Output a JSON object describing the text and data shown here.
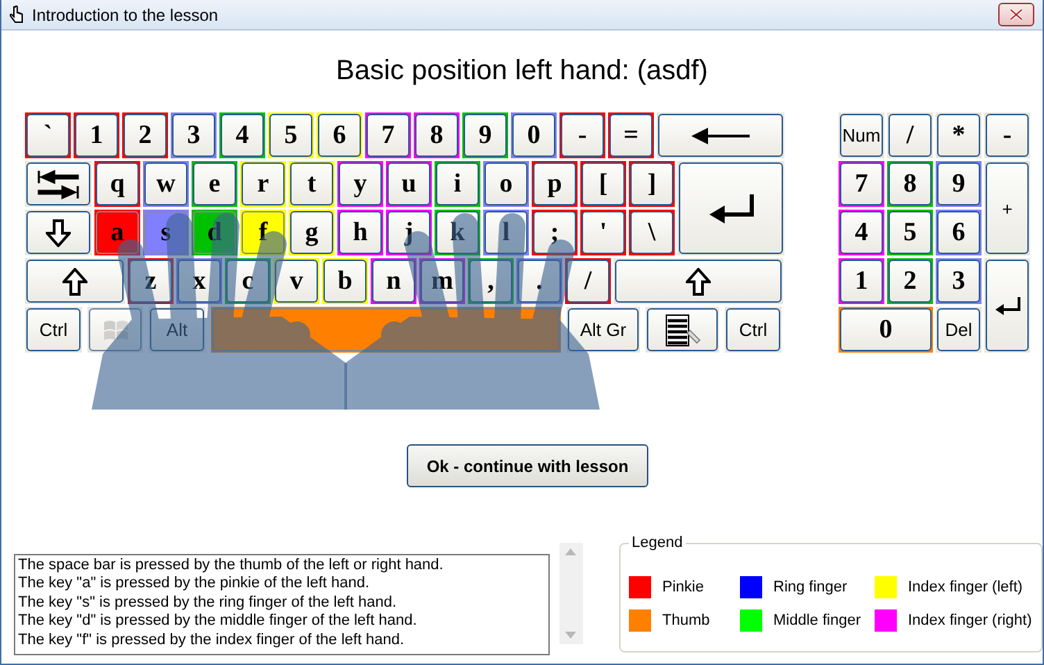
{
  "window": {
    "title": "Introduction to the lesson"
  },
  "heading": "Basic position left hand: (asdf)",
  "keyboard": {
    "rows": [
      {
        "keys": [
          {
            "kind": "char",
            "label": "`",
            "color": "#ff0000",
            "highlighted": false
          },
          {
            "kind": "char",
            "label": "1",
            "color": "#ff0000",
            "highlighted": false
          },
          {
            "kind": "char",
            "label": "2",
            "color": "#ff0000",
            "highlighted": false
          },
          {
            "kind": "char",
            "label": "3",
            "color": "#8080ff",
            "highlighted": false
          },
          {
            "kind": "char",
            "label": "4",
            "color": "#00c000",
            "highlighted": false
          },
          {
            "kind": "char",
            "label": "5",
            "color": "#ffff00",
            "highlighted": false
          },
          {
            "kind": "char",
            "label": "6",
            "color": "#ffff00",
            "highlighted": false
          },
          {
            "kind": "char",
            "label": "7",
            "color": "#ff00ff",
            "highlighted": false
          },
          {
            "kind": "char",
            "label": "8",
            "color": "#ff00ff",
            "highlighted": false
          },
          {
            "kind": "char",
            "label": "9",
            "color": "#00c000",
            "highlighted": false
          },
          {
            "kind": "char",
            "label": "0",
            "color": "#8080ff",
            "highlighted": false
          },
          {
            "kind": "char",
            "label": "-",
            "color": "#ff0000",
            "highlighted": false
          },
          {
            "kind": "char",
            "label": "=",
            "color": "#ff0000",
            "highlighted": false
          },
          {
            "kind": "backspace",
            "highlighted": false
          }
        ]
      },
      {
        "keys": [
          {
            "kind": "tab",
            "highlighted": false
          },
          {
            "kind": "char",
            "label": "q",
            "color": "#ff0000",
            "highlighted": false
          },
          {
            "kind": "char",
            "label": "w",
            "color": "#8080ff",
            "highlighted": false
          },
          {
            "kind": "char",
            "label": "e",
            "color": "#00c000",
            "highlighted": false
          },
          {
            "kind": "char",
            "label": "r",
            "color": "#ffff00",
            "highlighted": false
          },
          {
            "kind": "char",
            "label": "t",
            "color": "#ffff00",
            "highlighted": false
          },
          {
            "kind": "char",
            "label": "y",
            "color": "#ff00ff",
            "highlighted": false
          },
          {
            "kind": "char",
            "label": "u",
            "color": "#ff00ff",
            "highlighted": false
          },
          {
            "kind": "char",
            "label": "i",
            "color": "#00c000",
            "highlighted": false
          },
          {
            "kind": "char",
            "label": "o",
            "color": "#8080ff",
            "highlighted": false
          },
          {
            "kind": "char",
            "label": "p",
            "color": "#ff0000",
            "highlighted": false
          },
          {
            "kind": "char",
            "label": "[",
            "color": "#ff0000",
            "highlighted": false
          },
          {
            "kind": "char",
            "label": "]",
            "color": "#ff0000",
            "highlighted": false
          },
          {
            "kind": "enter",
            "highlighted": false
          }
        ]
      },
      {
        "keys": [
          {
            "kind": "caps",
            "highlighted": false
          },
          {
            "kind": "char",
            "label": "a",
            "color": "#ff0000",
            "highlighted": true
          },
          {
            "kind": "char",
            "label": "s",
            "color": "#8080ff",
            "highlighted": true
          },
          {
            "kind": "char",
            "label": "d",
            "color": "#00c000",
            "highlighted": true
          },
          {
            "kind": "char",
            "label": "f",
            "color": "#ffff00",
            "highlighted": true
          },
          {
            "kind": "char",
            "label": "g",
            "color": "#ffff00",
            "highlighted": false
          },
          {
            "kind": "char",
            "label": "h",
            "color": "#ff00ff",
            "highlighted": false
          },
          {
            "kind": "char",
            "label": "j",
            "color": "#ff00ff",
            "highlighted": false
          },
          {
            "kind": "char",
            "label": "k",
            "color": "#00c000",
            "highlighted": false
          },
          {
            "kind": "char",
            "label": "l",
            "color": "#8080ff",
            "highlighted": false
          },
          {
            "kind": "char",
            "label": ";",
            "color": "#ff0000",
            "highlighted": false
          },
          {
            "kind": "char",
            "label": "'",
            "color": "#ff0000",
            "highlighted": false
          },
          {
            "kind": "char",
            "label": "\\",
            "color": "#ff0000",
            "highlighted": false
          }
        ]
      },
      {
        "keys": [
          {
            "kind": "shift_left",
            "highlighted": false
          },
          {
            "kind": "char",
            "label": "z",
            "color": "#ff0000",
            "highlighted": false
          },
          {
            "kind": "char",
            "label": "x",
            "color": "#8080ff",
            "highlighted": false
          },
          {
            "kind": "char",
            "label": "c",
            "color": "#00c000",
            "highlighted": false
          },
          {
            "kind": "char",
            "label": "v",
            "color": "#ffff00",
            "highlighted": false
          },
          {
            "kind": "char",
            "label": "b",
            "color": "#ffff00",
            "highlighted": false
          },
          {
            "kind": "char",
            "label": "n",
            "color": "#ff00ff",
            "highlighted": false
          },
          {
            "kind": "char",
            "label": "m",
            "color": "#ff00ff",
            "highlighted": false
          },
          {
            "kind": "char",
            "label": ",",
            "color": "#00c000",
            "highlighted": false
          },
          {
            "kind": "char",
            "label": ".",
            "color": "#8080ff",
            "highlighted": false
          },
          {
            "kind": "char",
            "label": "/",
            "color": "#ff0000",
            "highlighted": false
          },
          {
            "kind": "shift_right",
            "highlighted": false
          }
        ]
      },
      {
        "keys": [
          {
            "kind": "ctrl",
            "label": "Ctrl",
            "highlighted": false
          },
          {
            "kind": "win",
            "highlighted": false
          },
          {
            "kind": "alt",
            "label": "Alt",
            "highlighted": false
          },
          {
            "kind": "space",
            "color": "#ff8000",
            "highlighted": true
          },
          {
            "kind": "altgr",
            "label": "Alt Gr",
            "highlighted": false
          },
          {
            "kind": "menu",
            "highlighted": false
          },
          {
            "kind": "ctrl",
            "label": "Ctrl",
            "highlighted": false
          }
        ]
      }
    ]
  },
  "numpad": {
    "keys": [
      {
        "kind": "word",
        "label": "Num",
        "highlighted": false
      },
      {
        "kind": "key",
        "label": "/",
        "highlighted": false
      },
      {
        "kind": "key",
        "label": "*",
        "highlighted": false
      },
      {
        "kind": "key",
        "label": "-",
        "highlighted": false
      },
      {
        "kind": "key",
        "label": "7",
        "color": "#ff00ff",
        "highlighted": false
      },
      {
        "kind": "key",
        "label": "8",
        "color": "#00c000",
        "highlighted": false
      },
      {
        "kind": "key",
        "label": "9",
        "color": "#8080ff",
        "highlighted": false
      },
      {
        "kind": "tall",
        "label": "+",
        "highlighted": false
      },
      {
        "kind": "key",
        "label": "4",
        "color": "#ff00ff",
        "highlighted": false
      },
      {
        "kind": "key",
        "label": "5",
        "color": "#00c000",
        "highlighted": false
      },
      {
        "kind": "key",
        "label": "6",
        "color": "#8080ff",
        "highlighted": false
      },
      {
        "kind": "key",
        "label": "1",
        "color": "#ff00ff",
        "highlighted": false
      },
      {
        "kind": "key",
        "label": "2",
        "color": "#00c000",
        "highlighted": false
      },
      {
        "kind": "key",
        "label": "3",
        "color": "#8080ff",
        "highlighted": false
      },
      {
        "kind": "enter",
        "highlighted": false
      },
      {
        "kind": "wide",
        "label": "0",
        "color": "#ff8000",
        "highlighted": false
      },
      {
        "kind": "word",
        "label": "Del",
        "highlighted": false
      }
    ]
  },
  "continue_button": "Ok - continue with lesson",
  "explanation": {
    "lines": [
      "The space bar is pressed by the thumb of the left or right hand.",
      "The key \"a\" is pressed by the pinkie of the left hand.",
      "The key \"s\" is pressed by the ring finger of the left hand.",
      "The key \"d\" is pressed by the middle finger of the left hand.",
      "The key \"f\" is pressed by the index finger of the left hand."
    ]
  },
  "legend": {
    "title": "Legend",
    "items": [
      {
        "label": "Pinkie",
        "color": "#ff0000"
      },
      {
        "label": "Ring finger",
        "color": "#0000ff"
      },
      {
        "label": "Index finger (left)",
        "color": "#ffff00"
      },
      {
        "label": "Thumb",
        "color": "#ff8000"
      },
      {
        "label": "Middle finger",
        "color": "#00ff00"
      },
      {
        "label": "Index finger (right)",
        "color": "#ff00ff"
      }
    ]
  }
}
